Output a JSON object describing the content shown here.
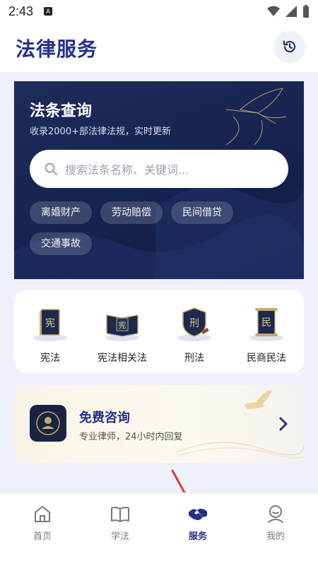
{
  "status_bar": {
    "time": "2:43"
  },
  "header": {
    "title": "法律服务"
  },
  "hero": {
    "title": "法条查询",
    "subtitle": "收录2000+部法律法规，实时更新",
    "search_placeholder": "搜索法条名称、关键词...",
    "tags": [
      "离婚财产",
      "劳动赔偿",
      "民间借贷",
      "交通事故"
    ]
  },
  "categories": [
    {
      "label": "宪法",
      "glyph": "宪",
      "icon": "book-icon"
    },
    {
      "label": "宪法相关法",
      "glyph": "宪",
      "icon": "book-icon"
    },
    {
      "label": "刑法",
      "glyph": "刑",
      "icon": "shield-icon"
    },
    {
      "label": "民商民法",
      "glyph": "民",
      "icon": "scroll-icon"
    }
  ],
  "consult": {
    "title": "免费咨询",
    "subtitle": "专业律师，24小时内回复"
  },
  "tabbar": {
    "items": [
      {
        "label": "首页",
        "icon": "home-icon",
        "active": false
      },
      {
        "label": "学法",
        "icon": "book-open-icon",
        "active": false
      },
      {
        "label": "服务",
        "icon": "handshake-icon",
        "active": true
      },
      {
        "label": "我的",
        "icon": "user-icon",
        "active": false
      }
    ]
  },
  "colors": {
    "accent": "#23318c",
    "hero_bg": "#162350",
    "page_bg": "#eef1fb",
    "annotation_arrow": "#e53935"
  }
}
